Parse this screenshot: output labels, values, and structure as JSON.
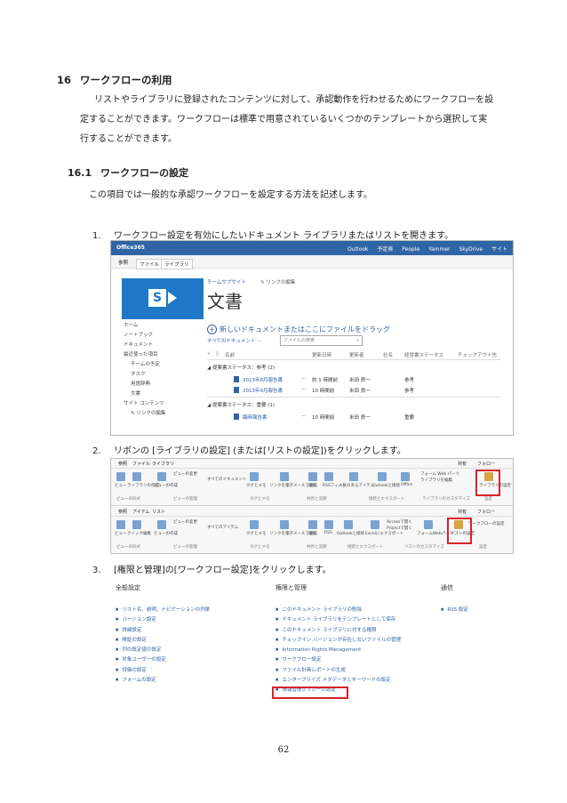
{
  "section": {
    "number": "16",
    "title": "ワークフローの利用"
  },
  "intro": {
    "line1": "リストやライブラリに登録されたコンテンツに対して、承認動作を行わせるためにワークフローを設",
    "line2": "定することができます。ワークフローは標準で用意されているいくつかのテンプレートから選択して実",
    "line3": "行することができます。"
  },
  "subsection": {
    "number": "16.1",
    "title": "ワークフローの設定"
  },
  "subsection_text": "この項目では一般的な承認ワークフローを設定する方法を記述します。",
  "steps": [
    {
      "n": "1.",
      "text": "ワークフロー設定を有効にしたいドキュメント ライブラリまたはリストを開きます。"
    },
    {
      "n": "2.",
      "text": "リボンの [ライブラリの設定] (または[リストの設定])をクリックします。"
    },
    {
      "n": "3.",
      "text": "[権限と管理]の[ワークフロー設定]をクリックします。"
    }
  ],
  "shot1": {
    "brand": "Office365",
    "top_links": [
      "Outlook",
      "予定表",
      "People",
      "Yammer",
      "SkyDrive",
      "サイト"
    ],
    "tabs": [
      "参照",
      "ファイル",
      "ライブラリ"
    ],
    "site_link": "チームサブサイト",
    "edit_link": "リンクの編集",
    "title": "文書",
    "nav": [
      "ホーム",
      "ノートブック",
      "ドキュメント",
      "最近使った項目",
      "チームの予定",
      "タスク",
      "用語辞典",
      "文書",
      "サイト コンテンツ",
      "リンクの編集"
    ],
    "newdoc": "新しいドキュメントまたはここにファイルをドラッグ",
    "all_docs": "すべてのドキュメント",
    "search_placeholder": "ファイルの検索",
    "headers": [
      "名前",
      "更新日時",
      "更新者",
      "社名",
      "経営書ステータス",
      "チェックアウト先"
    ],
    "group1": "◢ 提案書ステータス：参考 (2)",
    "group2": "◢ 提案書ステータス：重要 (1)",
    "rows": [
      {
        "name": "2013年8月報告書",
        "date": "約 1 時間前",
        "user": "米田 貢一",
        "status": "参考"
      },
      {
        "name": "2013年9月報告書",
        "date": "10 時間前",
        "user": "米田 貢一",
        "status": "参考"
      },
      {
        "name": "臨時報告書",
        "date": "10 時間前",
        "user": "米田 貢一",
        "status": "重要"
      }
    ]
  },
  "shot2": {
    "rib1_tabs": [
      "参照",
      "ファイル",
      "ライブラリ",
      "共有",
      "フォロー"
    ],
    "rib1_buttons": [
      "ビュー",
      "ライブラリの作成",
      "ビューの作成",
      "ビューの変更",
      "すべてのドキュメント",
      "タグとメモ",
      "リンクを電子メールで送信",
      "通知",
      "RSSフィード",
      "人気のあるアイテム",
      "Outlookと接続",
      "Office",
      "フォーム Web パーツ",
      "ライブラリを編集",
      "ライブラリの設定"
    ],
    "rib1_groups": [
      "ビューの形式",
      "ビューの管理",
      "タグとメモ",
      "共有と追跡",
      "接続とエクスポート",
      "ライブラリのカスタマイズ",
      "設定"
    ],
    "rib2_tabs": [
      "参照",
      "アイテム",
      "リスト",
      "共有",
      "フォロー"
    ],
    "rib2_buttons": [
      "ビュー",
      "クイック編集",
      "ビューの作成",
      "ビューの変更",
      "すべてのアイテム",
      "タグとメモ",
      "リンクを電子メールで送信",
      "通知",
      "RSS",
      "Outlookと接続",
      "Excelにエクスポート",
      "Accessで開く",
      "Projectで開く",
      "フォームWebパーツ",
      "リストの設定",
      "ワークフローの設定"
    ],
    "rib2_groups": [
      "ビューの形式",
      "ビューの管理",
      "タグとメモ",
      "共有と追跡",
      "接続とエクスポート",
      "リストのカスタマイズ",
      "設定"
    ]
  },
  "shot3": {
    "col1_head": "全般設定",
    "col1_items": [
      "リスト名、説明、ナビゲーションの列挙",
      "バージョン設定",
      "詳細設定",
      "検証の設定",
      "列の既定値の設定",
      "対象ユーザーの設定",
      "評価の設定",
      "フォームの設定"
    ],
    "col2_head": "権限と管理",
    "col2_items": [
      "このドキュメント ライブラリの削除",
      "ドキュメント ライブラリをテンプレートとして保存",
      "このドキュメント ライブラリに対する権限",
      "チェックイン バージョンが存在しないファイルの管理",
      "Information Rights Management",
      "ワークフロー設定",
      "ファイル計画レポートの生成",
      "エンタープライズ メタデータとキーワードの設定",
      "情報管理ポリシーの設定"
    ],
    "col3_head": "通信",
    "col3_items": [
      "RSS 設定"
    ]
  },
  "page_number": "62"
}
